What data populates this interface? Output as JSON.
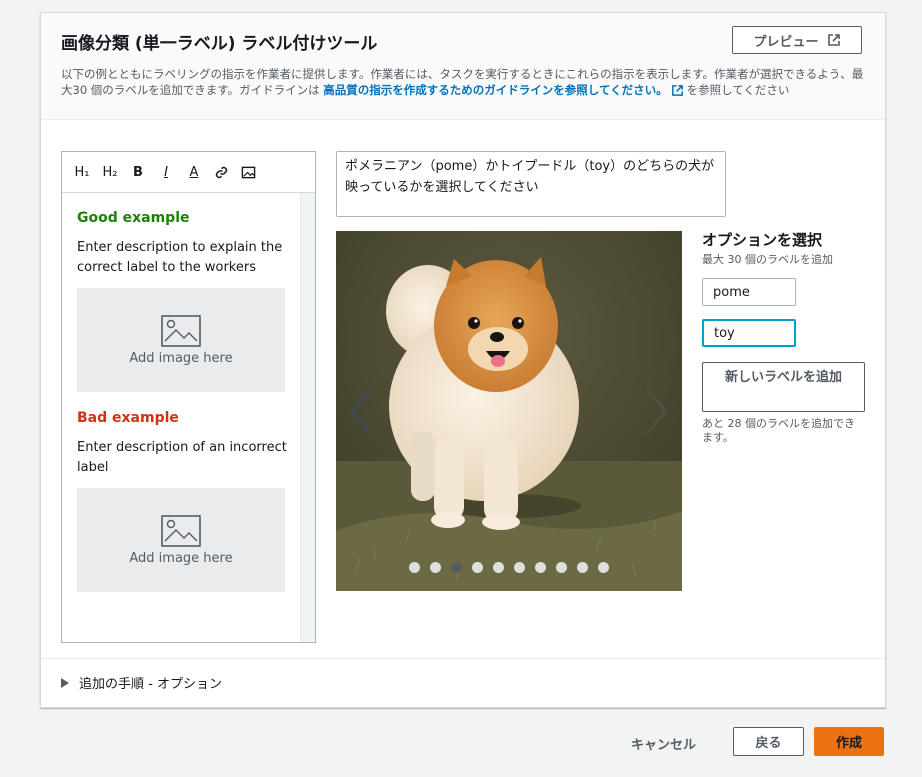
{
  "header": {
    "title": "画像分類 (単一ラベル) ラベル付けツール",
    "preview_label": "プレビュー",
    "desc_part1": "以下の例とともにラベリングの指示を作業者に提供します。作業者には、タスクを実行するときにこれらの指示を表示します。作業者が選択できるよう、最大30 個のラベルを追加できます。ガイドラインは ",
    "desc_link": "高品質の指示を作成するためのガイドラインを参照してください。",
    "desc_part2": "を参照してください"
  },
  "editor": {
    "toolbar": [
      "H₁",
      "H₂",
      "B",
      "I",
      "A"
    ],
    "good_title": "Good example",
    "good_text": "Enter description to explain the correct label to the workers",
    "add_image": "Add image here",
    "bad_title": "Bad example",
    "bad_text": "Enter description of an incorrect label"
  },
  "question": "ポメラニアン（pome）かトイプードル（toy）のどちらの犬が映っているかを選択してください",
  "carousel": {
    "dot_count": 10,
    "active_index": 2
  },
  "options": {
    "title": "オプションを選択",
    "subtitle": "最大 30 個のラベルを追加",
    "labels": [
      "pome",
      "toy"
    ],
    "add_button": "新しいラベルを追加",
    "remaining": "あと 28 個のラベルを追加できます。"
  },
  "instructions_toggle": "追加の手順 - オプション",
  "footer": {
    "cancel": "キャンセル",
    "back": "戻る",
    "create": "作成"
  },
  "colors": {
    "primary": "#ec7211",
    "link": "#0073bb",
    "good": "#1d8102",
    "bad": "#d13212"
  }
}
